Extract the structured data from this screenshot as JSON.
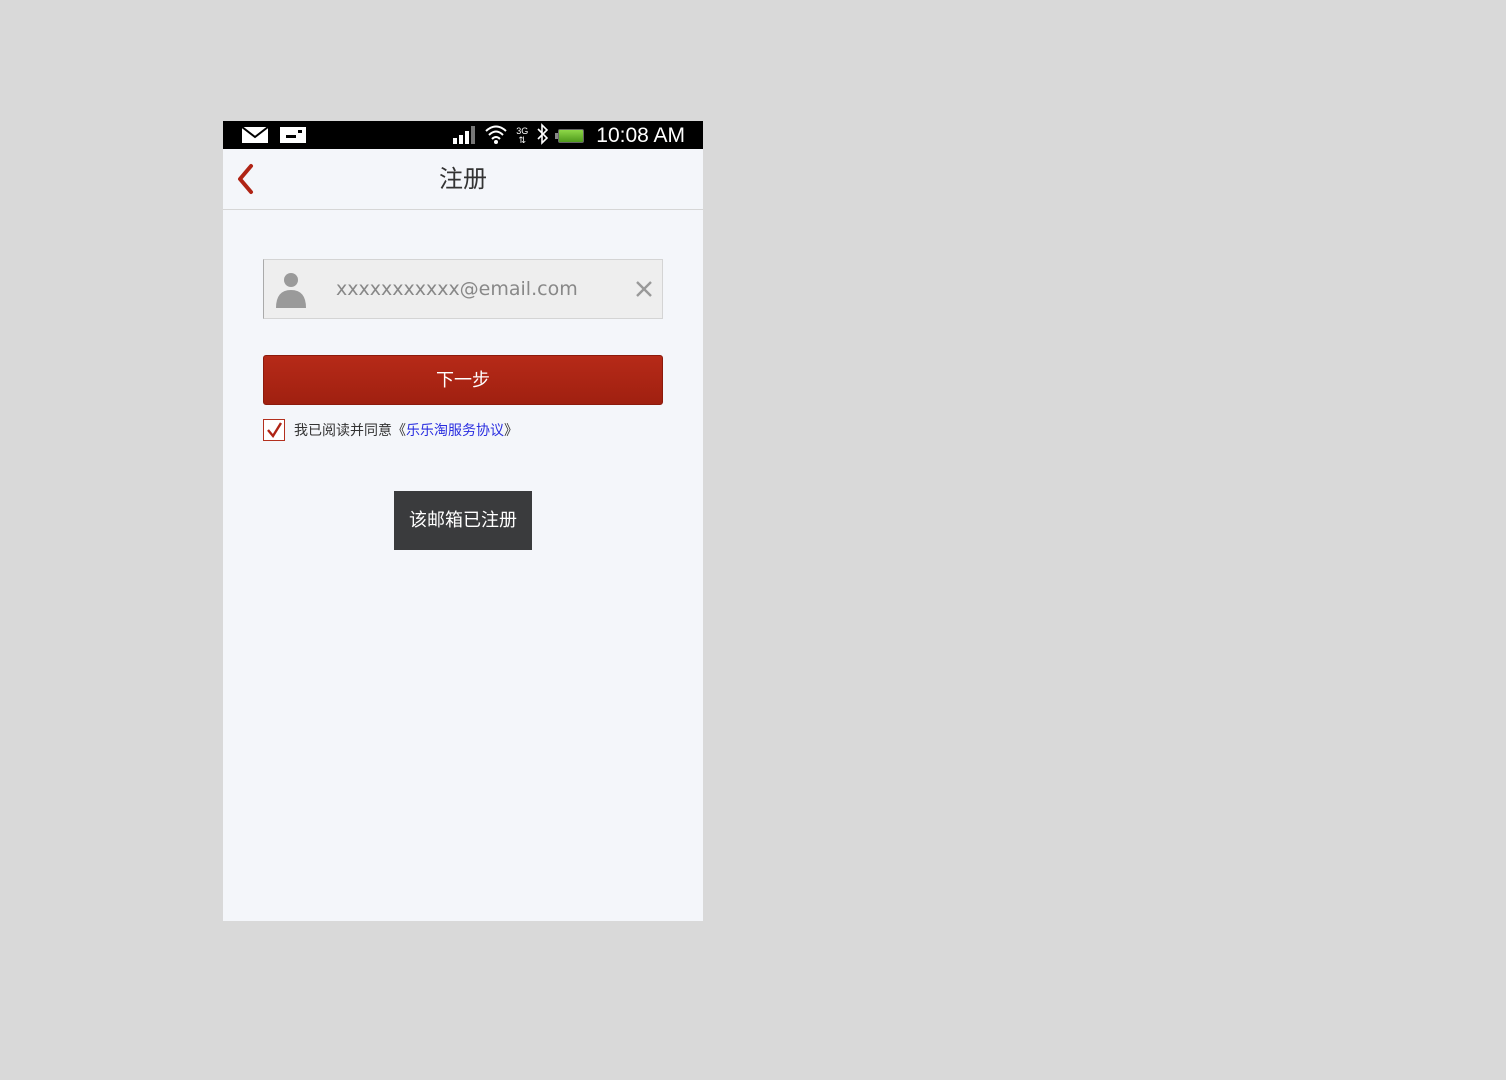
{
  "status_bar": {
    "time": "10:08 AM",
    "network": "3G",
    "icons": [
      "mail-icon",
      "sim-icon",
      "signal-icon",
      "wifi-icon",
      "network-3g-icon",
      "bluetooth-icon",
      "battery-icon"
    ]
  },
  "header": {
    "title": "注册",
    "back_icon": "chevron-left-icon"
  },
  "form": {
    "email": {
      "value": "",
      "placeholder": "xxxxxxxxxxx@email.com",
      "leading_icon": "user-icon",
      "clear_icon": "close-icon"
    },
    "next_button_label": "下一步",
    "agreement": {
      "checked": true,
      "prefix": "我已阅读并同意《",
      "link_text": "乐乐淘服务协议",
      "suffix": "》"
    }
  },
  "toast": {
    "message": "该邮箱已注册"
  },
  "colors": {
    "accent": "#b02415",
    "link": "#2a2ee0",
    "toast_bg": "#3a3b3d",
    "page_bg": "#f4f6fa"
  }
}
